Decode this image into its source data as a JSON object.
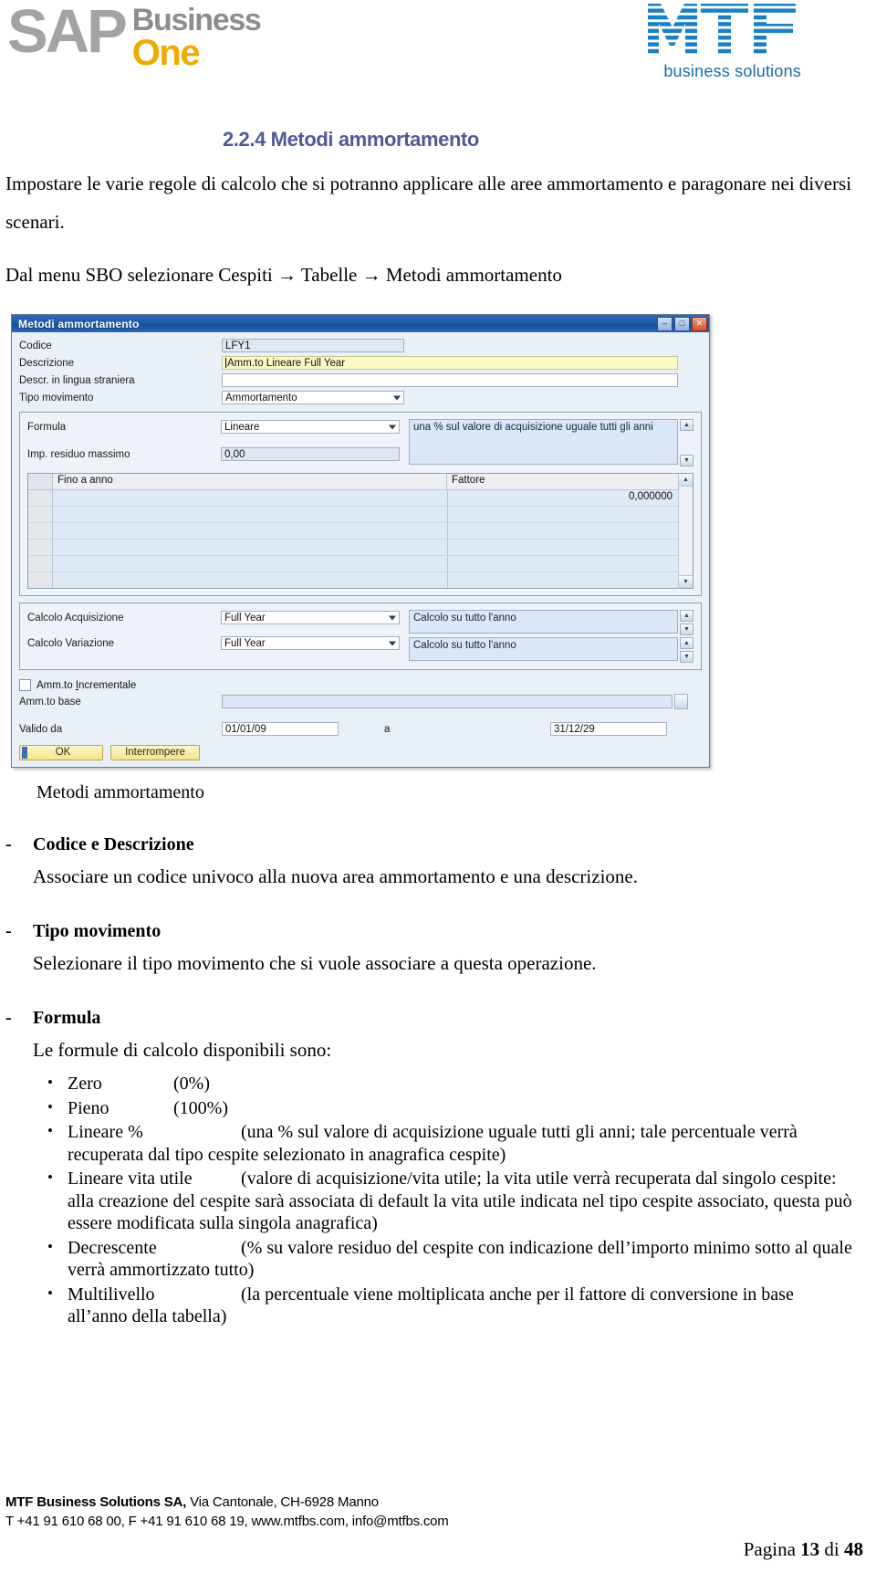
{
  "header": {
    "sap_logo": {
      "sap": "SAP",
      "business": "Business",
      "one": "One"
    },
    "mtf_logo": {
      "mark": "MTF",
      "tagline": "business solutions"
    }
  },
  "document": {
    "section_title": "2.2.4 Metodi ammortamento",
    "intro": "Impostare le varie regole di calcolo che si potranno applicare alle aree ammortamento e paragonare nei diversi scenari.",
    "menu_path": "Dal menu SBO selezionare Cespiti → Tabelle → Metodi ammortamento",
    "screenshot_caption": "Metodi ammortamento"
  },
  "dialog": {
    "title": "Metodi ammortamento",
    "window_buttons": {
      "minimize": "–",
      "maximize": "□",
      "close": "✕"
    },
    "fields": {
      "codice_label": "Codice",
      "codice_value": "LFY1",
      "descrizione_label": "Descrizione",
      "descrizione_value": "Amm.to Lineare Full Year",
      "descr_straniera_label": "Descr. in lingua straniera",
      "descr_straniera_value": "",
      "tipo_movimento_label": "Tipo movimento",
      "tipo_movimento_value": "Ammortamento",
      "formula_label": "Formula",
      "formula_value": "Lineare",
      "formula_note": "una % sul valore di acquisizione uguale tutti gli anni",
      "imp_residuo_label": "Imp. residuo massimo",
      "imp_residuo_value": "0,00",
      "calcolo_acquisizione_label": "Calcolo Acquisizione",
      "calcolo_acquisizione_value": "Full Year",
      "calcolo_acquisizione_note": "Calcolo su tutto l'anno",
      "calcolo_variazione_label": "Calcolo Variazione",
      "calcolo_variazione_value": "Full Year",
      "calcolo_variazione_note": "Calcolo su tutto l'anno",
      "amm_incrementale_label": "Amm.to Incrementale",
      "amm_incrementale_checked": false,
      "amm_base_label": "Amm.to base",
      "amm_base_value": "",
      "valido_da_label": "Valido da",
      "valido_da_value": "01/01/09",
      "valido_a_label": "a",
      "valido_a_value": "31/12/29"
    },
    "grid": {
      "col_year": "Fino a anno",
      "col_factor": "Fattore",
      "rows": [
        {
          "year": "",
          "factor": "0,000000"
        },
        {
          "year": "",
          "factor": ""
        },
        {
          "year": "",
          "factor": ""
        },
        {
          "year": "",
          "factor": ""
        },
        {
          "year": "",
          "factor": ""
        },
        {
          "year": "",
          "factor": ""
        }
      ]
    },
    "buttons": {
      "ok": "OK",
      "cancel": "Interrompere"
    },
    "scroll_glyphs": {
      "up": "▲",
      "down": "▼"
    }
  },
  "definitions": [
    {
      "title": "Codice e Descrizione",
      "body": "Associare un codice univoco alla nuova area ammortamento e una descrizione."
    },
    {
      "title": "Tipo movimento",
      "body": "Selezionare il tipo movimento che si vuole associare a questa operazione."
    },
    {
      "title": "Formula",
      "body": "Le formule di calcolo disponibili sono:"
    }
  ],
  "formulas": [
    {
      "name": "Zero",
      "desc": "(0%)",
      "width": "w1"
    },
    {
      "name": "Pieno",
      "desc": "(100%)",
      "width": "w1"
    },
    {
      "name": "Lineare %",
      "desc": "(una % sul valore di acquisizione uguale tutti gli anni; tale percentuale verrà recuperata dal tipo cespite selezionato in anagrafica cespite)",
      "width": "w2"
    },
    {
      "name": "Lineare vita utile",
      "desc": "(valore di acquisizione/vita utile; la vita utile verrà recuperata dal singolo cespite: alla creazione del cespite sarà associata di default la vita utile indicata nel tipo cespite associato, questa può essere modificata sulla singola anagrafica)",
      "width": "w2"
    },
    {
      "name": "Decrescente",
      "desc": "(% su valore residuo del cespite con indicazione dell’importo minimo sotto al quale verrà ammortizzato tutto)",
      "width": "w2"
    },
    {
      "name": "Multilivello",
      "desc": "(la percentuale viene moltiplicata anche per il fattore di conversione in base all’anno della tabella)",
      "width": "w2"
    }
  ],
  "footer": {
    "company": "MTF Business Solutions SA,",
    "address": " Via Cantonale, CH-6928 Manno",
    "contact": "T +41 91 610 68 00, F +41 91 610 68 19, www.mtfbs.com, info@mtfbs.com",
    "page_prefix": "Pagina ",
    "page_current": "13",
    "page_mid": " di ",
    "page_total": "48"
  }
}
